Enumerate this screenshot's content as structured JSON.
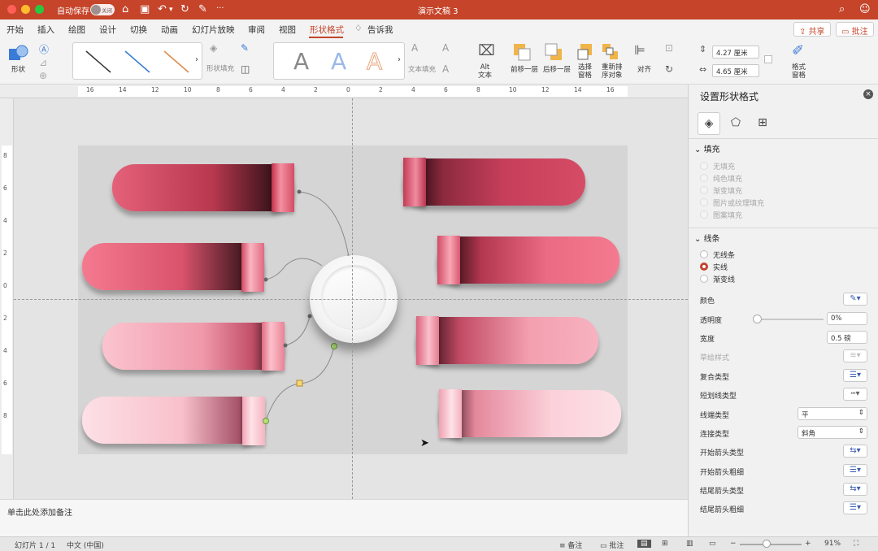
{
  "titlebar": {
    "autosave_label": "自动保存",
    "autosave_state": "关闭",
    "document_title": "演示文稿 3",
    "more": "···"
  },
  "tabs": [
    "开始",
    "插入",
    "绘图",
    "设计",
    "切换",
    "动画",
    "幻灯片放映",
    "审阅",
    "视图",
    "形状格式",
    "告诉我"
  ],
  "active_tab": "形状格式",
  "share_label": "共享",
  "comment_label": "批注",
  "ribbon": {
    "shapes_label": "形状",
    "shape_fill_label": "形状填充",
    "text_fill_label": "文本填充",
    "alt_text_label": "Alt\n文本",
    "bring_forward_label": "前移一层",
    "send_backward_label": "后移一层",
    "selection_pane_label": "选择\n窗格",
    "reorder_label": "重新排\n序对象",
    "align_label": "对齐",
    "height_value": "4.27 厘米",
    "width_value": "4.65 厘米",
    "format_pane_label": "格式\n窗格",
    "wordart_letter": "A"
  },
  "ruler_labels": [
    "16",
    "14",
    "12",
    "10",
    "8",
    "6",
    "4",
    "2",
    "0",
    "2",
    "4",
    "6",
    "8",
    "10",
    "12",
    "14",
    "16"
  ],
  "vruler_labels": [
    "8",
    "6",
    "4",
    "2",
    "0",
    "2",
    "4",
    "6",
    "8"
  ],
  "notes_placeholder": "单击此处添加备注",
  "statusbar": {
    "slide_info": "幻灯片 1 / 1",
    "language": "中文 (中国)",
    "notes_label": "备注",
    "comments_label": "批注",
    "zoom": "91%"
  },
  "panel": {
    "title": "设置形状格式",
    "fill_section": "填充",
    "fill_options": [
      "无填充",
      "纯色填充",
      "渐变填充",
      "图片或纹理填充",
      "图案填充"
    ],
    "line_section": "线条",
    "line_options": [
      "无线条",
      "实线",
      "渐变线"
    ],
    "line_selected": "实线",
    "color_label": "颜色",
    "transparency_label": "透明度",
    "transparency_value": "0%",
    "transparency_slider": 0.0,
    "width_label": "宽度",
    "width_value": "0.5 磅",
    "sketch_label": "草绘样式",
    "compound_label": "复合类型",
    "dash_label": "短划线类型",
    "cap_label": "线端类型",
    "cap_value": "平",
    "join_label": "连接类型",
    "join_value": "斜角",
    "begin_arrow_type_label": "开始箭头类型",
    "begin_arrow_size_label": "开始箭头粗细",
    "end_arrow_type_label": "结尾箭头类型",
    "end_arrow_size_label": "结尾箭头粗细"
  },
  "colors": {
    "accent": "#c5442a",
    "slide_bg": "#d5d5d5",
    "bar_dark": "#c23a55",
    "bar_mid": "#f07f93",
    "bar_light": "#fbd5dc"
  }
}
